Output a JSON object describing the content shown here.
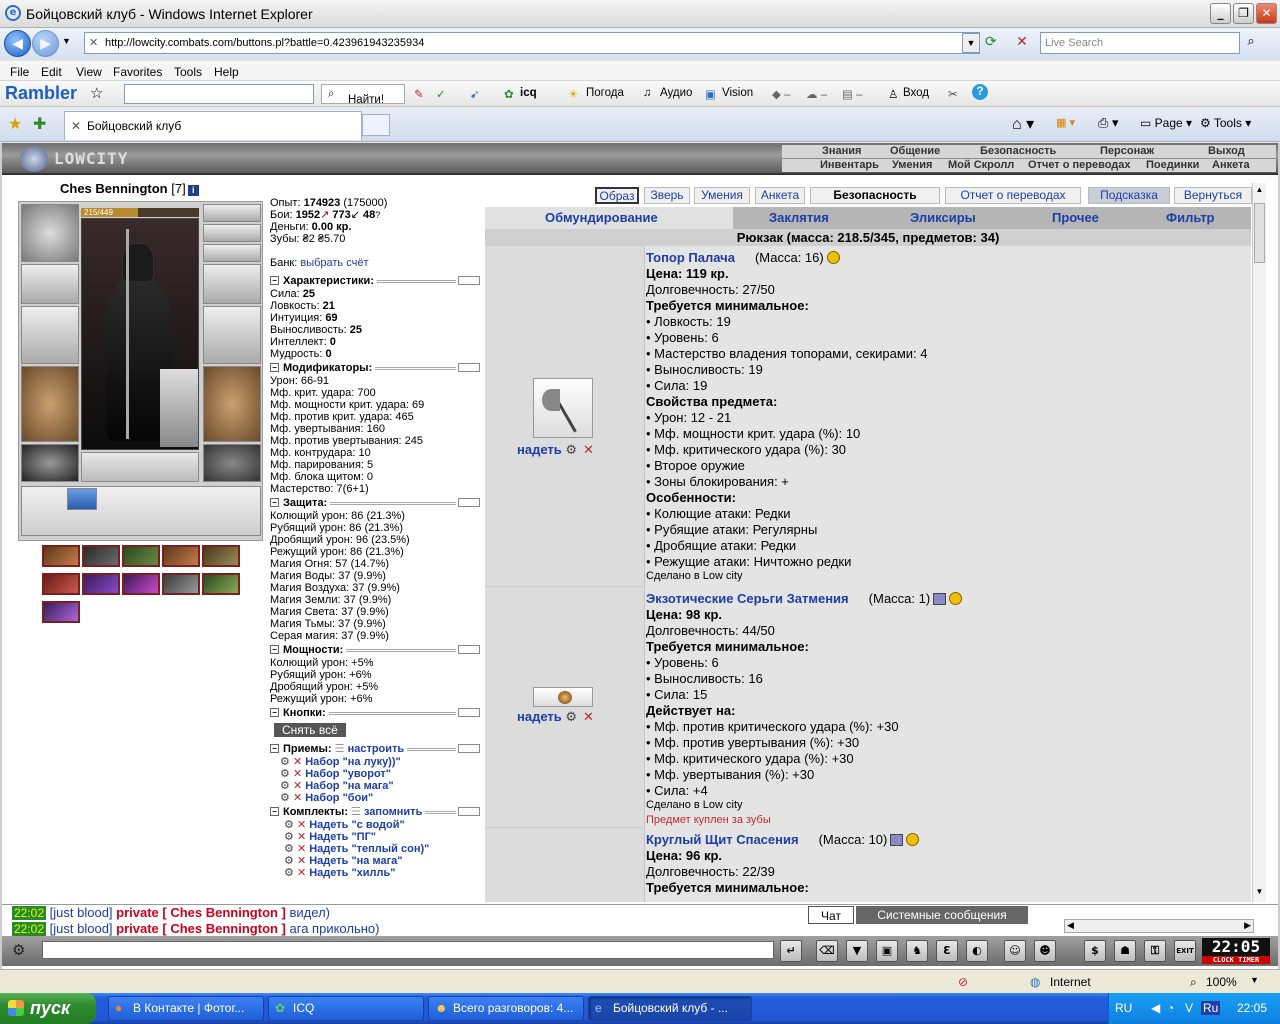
{
  "window": {
    "title": "Бойцовский клуб - Windows Internet Explorer"
  },
  "address": {
    "url": "http://lowcity.combats.com/buttons.pl?battle=0.423961943235934",
    "search_placeholder": "Live Search"
  },
  "menu": [
    "File",
    "Edit",
    "View",
    "Favorites",
    "Tools",
    "Help"
  ],
  "rambler": {
    "logo": "Rambler",
    "find": "Найти!",
    "icq": "icq",
    "weather": "Погода",
    "audio": "Аудио",
    "vision": "Vision",
    "login": "Вход"
  },
  "tabs": {
    "active": "Бойцовский клуб",
    "page": "Page",
    "tools": "Tools"
  },
  "game": {
    "logo": "LOWCITY",
    "topnav1": [
      "Знания",
      "Общение",
      "Безопасность",
      "Персонаж",
      "Выход"
    ],
    "topnav2": [
      "Инвентарь",
      "Умения",
      "Мой Скролл",
      "Отчет о переводах",
      "Поединки",
      "Анкета"
    ]
  },
  "character": {
    "name": "Ches Bennington",
    "level": "[7]",
    "hp": "215/449",
    "hp_fraction": 0.48
  },
  "stats": {
    "exp_label": "Опыт:",
    "exp": "174923",
    "exp_next": "(175000)",
    "fights_label": "Бои:",
    "wins": "1952",
    "losses": "773",
    "draws": "48",
    "money_label": "Деньги:",
    "money": "0.00 кр.",
    "teeth_label": "Зубы:",
    "teeth": "₴2 ₴5.70",
    "bank_label": "Банк:",
    "bank_link": "выбрать счёт"
  },
  "sections": {
    "chars": "Характеристики:",
    "mods": "Модификаторы:",
    "protect": "Защита:",
    "power": "Мощности:",
    "buttons": "Кнопки:",
    "tricks": "Приемы:",
    "tricks_link": "настроить",
    "sets": "Комплекты:",
    "sets_link": "запомнить"
  },
  "attributes": [
    {
      "k": "Сила:",
      "v": "25"
    },
    {
      "k": "Ловкость:",
      "v": "21"
    },
    {
      "k": "Интуиция:",
      "v": "69"
    },
    {
      "k": "Выносливость:",
      "v": "25"
    },
    {
      "k": "Интеллект:",
      "v": "0"
    },
    {
      "k": "Мудрость:",
      "v": "0"
    }
  ],
  "modifiers": [
    "Урон: 66-91",
    "Мф. крит. удара: 700",
    "Мф. мощности крит. удара: 69",
    "Мф. против крит. удара: 465",
    "Мф. увертывания: 160",
    "Мф. против увертывания: 245",
    "Мф. контрудара: 10",
    "Мф. парирования: 5",
    "Мф. блока щитом: 0",
    "Мастерство: 7(6+1)"
  ],
  "protection": [
    "Колющий урон: 86 (21.3%)",
    "Рубящий урон: 86 (21.3%)",
    "Дробящий урон: 96 (23.5%)",
    "Режущий урон: 86 (21.3%)",
    "Магия Огня: 57 (14.7%)",
    "Магия Воды: 37 (9.9%)",
    "Магия Воздуха: 37 (9.9%)",
    "Магия Земли: 37 (9.9%)",
    "Магия Света: 37 (9.9%)",
    "Магия Тьмы: 37 (9.9%)",
    "Серая магия: 37 (9.9%)"
  ],
  "powers": [
    "Колющий урон: +5%",
    "Рубящий урон: +6%",
    "Дробящий урон: +5%",
    "Режущий урон: +6%"
  ],
  "reset_button": "Снять всё",
  "trick_sets": [
    "Набор \"на луку))\"",
    "Набор \"уворот\"",
    "Набор \"на мага\"",
    "Набор \"бои\""
  ],
  "kits": [
    "Надеть \"с водой\"",
    "Надеть \"ПГ\"",
    "Надеть \"теплый сон)\"",
    "Надеть \"на мага\"",
    "Надеть \"хилль\""
  ],
  "topbuttons": [
    "Образ",
    "Зверь",
    "Умения",
    "Анкета",
    "Безопасность",
    "Отчет о переводах",
    "Подсказка",
    "Вернуться"
  ],
  "invtabs": [
    "Обмундирование",
    "Заклятия",
    "Эликсиры",
    "Прочее",
    "Фильтр"
  ],
  "backpack": "Рюкзак (масса: 218.5/345, предметов: 34)",
  "wear_label": "надеть",
  "items": [
    {
      "name": "Топор Палача",
      "mass": "(Масса: 16)",
      "price": "Цена: 119 кр.",
      "durability": "Долговечность: 27/50",
      "req_title": "Требуется минимальное:",
      "req": [
        "• Ловкость: 19",
        "• Уровень: 6",
        "• Мастерство владения топорами, секирами: 4",
        "• Выносливость: 19",
        "• Сила: 19"
      ],
      "prop_title": "Свойства предмета:",
      "props": [
        "• Урон: 12 - 21",
        "• Мф. мощности крит. удара (%): 10",
        "• Мф. критического удара (%): 30",
        "• Второе оружие",
        "• Зоны блокирования: +"
      ],
      "feat_title": "Особенности:",
      "feats": [
        "• Колющие атаки: Редки",
        "• Рубящие атаки: Регулярны",
        "• Дробящие атаки: Редки",
        "• Режущие атаки: Ничтожно редки"
      ],
      "made": "Сделано в Low city"
    },
    {
      "name": "Экзотические Серьги Затмения",
      "mass": "(Масса: 1)",
      "price": "Цена: 98 кр.",
      "durability": "Долговечность: 44/50",
      "req_title": "Требуется минимальное:",
      "req": [
        "• Уровень: 6",
        "• Выносливость: 16",
        "• Сила: 15"
      ],
      "prop_title": "Действует на:",
      "props": [
        "• Мф. против критического удара (%): +30",
        "• Мф. против увертывания (%): +30",
        "• Мф. критического удара (%): +30",
        "• Мф. увертывания (%): +30",
        "• Сила: +4"
      ],
      "made": "Сделано в Low city",
      "bought": "Предмет куплен за зубы"
    },
    {
      "name": "Круглый Щит Спасения",
      "mass": "(Масса: 10)",
      "price": "Цена: 96 кр.",
      "durability": "Долговечность: 22/39",
      "req_title": "Требуется минимальное:"
    }
  ],
  "chat": {
    "lines": [
      {
        "time": "22:02",
        "from": "[just blood]",
        "to": "private [ Ches Bennington ]",
        "msg": "видел)"
      },
      {
        "time": "22:02",
        "from": "[just blood]",
        "to": "private [ Ches Bennington ]",
        "msg": "ага прикольно)"
      }
    ],
    "tab_chat": "Чат",
    "tab_system": "Системные сообщения",
    "clock": "22:05",
    "clock_label": "CLOCK TIMER"
  },
  "status": {
    "zone": "Internet",
    "zoom": "100%"
  },
  "taskbar": {
    "start": "пуск",
    "tasks": [
      "В Контакте | Фотог...",
      "ICQ",
      "Всего разговоров: 4...",
      "Бойцовский клуб - ..."
    ],
    "lang": "RU",
    "time": "22:05"
  }
}
